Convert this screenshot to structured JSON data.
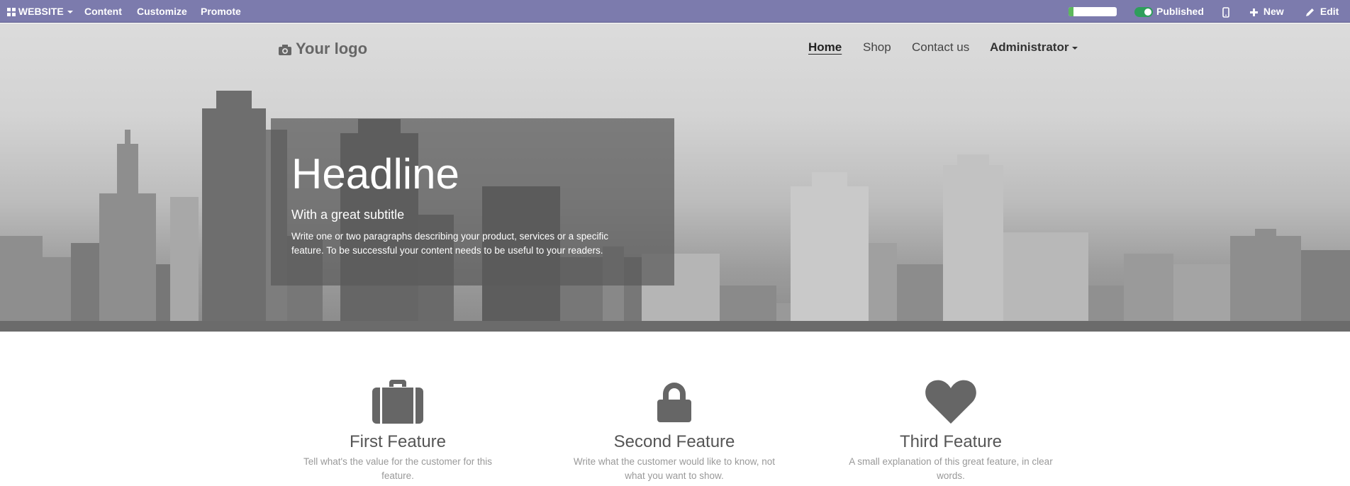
{
  "adminbar": {
    "website_label": "WEBSITE",
    "menu": [
      "Content",
      "Customize",
      "Promote"
    ],
    "progress_fraction": 0.1,
    "published_label": "Published",
    "new_label": "New",
    "edit_label": "Edit",
    "icons": [
      "apps-icon",
      "mobile-icon",
      "plus-icon",
      "pencil-icon"
    ]
  },
  "header": {
    "logo_text": "Your logo",
    "logo_icon": "camera-icon",
    "nav": [
      "Home",
      "Shop",
      "Contact us",
      "Administrator"
    ],
    "active_nav": "Home"
  },
  "hero": {
    "headline": "Headline",
    "subtitle": "With a great subtitle",
    "paragraph": "Write one or two paragraphs describing your product, services or a specific feature. To be successful your content needs to be useful to your readers."
  },
  "features": [
    {
      "icon": "briefcase-icon",
      "title": "First Feature",
      "description": "Tell what's the value for the customer for this feature."
    },
    {
      "icon": "lock-icon",
      "title": "Second Feature",
      "description": "Write what the customer would like to know, not what you want to show."
    },
    {
      "icon": "heart-icon",
      "title": "Third Feature",
      "description": "A small explanation of this great feature, in clear words."
    }
  ],
  "colors": {
    "adminbar": "#7c7bad",
    "published_toggle": "#2e9e5b",
    "feature_icon": "#666666"
  }
}
